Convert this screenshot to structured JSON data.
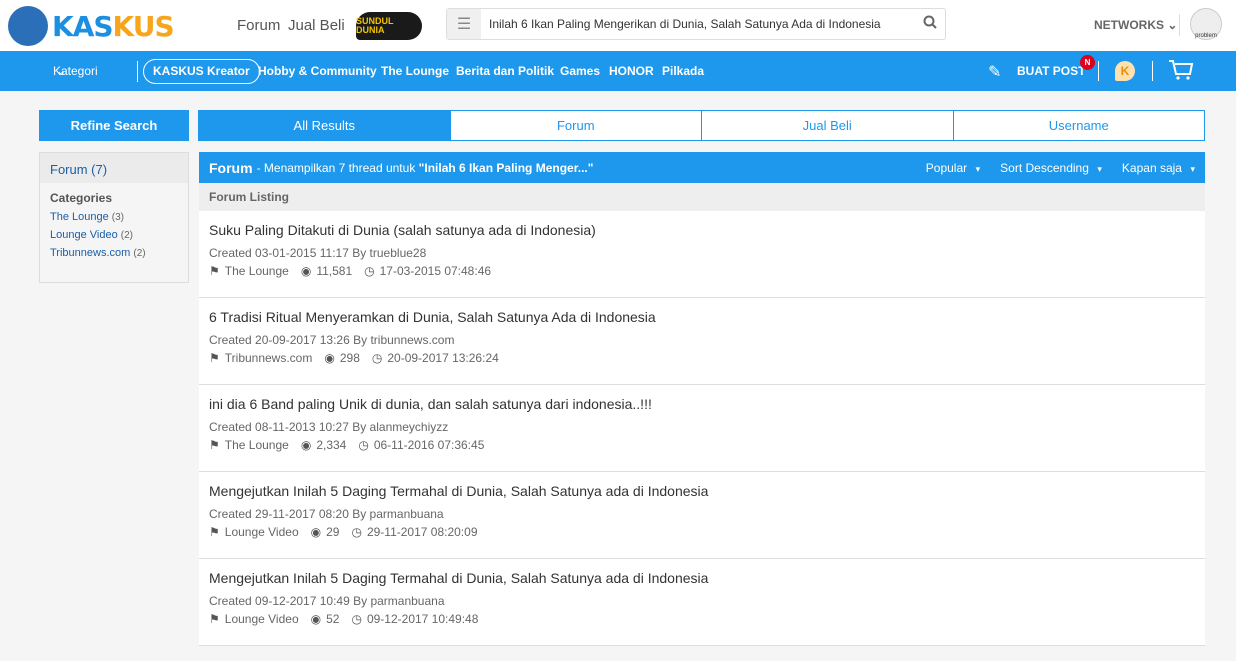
{
  "header": {
    "logo_a": "KAS",
    "logo_b": "KUS",
    "links": [
      "Forum",
      "Jual Beli"
    ],
    "sundul": "SUNDUL DUNIA",
    "search_value": "Inilah 6 Ikan Paling Mengerikan di Dunia, Salah Satunya Ada di Indonesia",
    "networks": "NETWORKS",
    "avatar_caption": "problem"
  },
  "nav": {
    "kategori": "Kategori",
    "kreator": "KASKUS Kreator",
    "items": [
      "Hobby & Community",
      "The Lounge",
      "Berita dan Politik",
      "Games",
      "HONOR",
      "Pilkada"
    ],
    "buat_post": "BUAT POST",
    "badge": "N"
  },
  "colors": {
    "accent": "#1e98ec",
    "badge": "#e0001b"
  },
  "refine": "Refine Search",
  "tabs": [
    "All Results",
    "Forum",
    "Jual Beli",
    "Username"
  ],
  "sidebar": {
    "header": "Forum (7)",
    "categories_label": "Categories",
    "items": [
      {
        "name": "The Lounge",
        "count": "(3)"
      },
      {
        "name": "Lounge Video",
        "count": "(2)"
      },
      {
        "name": "Tribunnews.com",
        "count": "(2)"
      }
    ]
  },
  "main": {
    "title": "Forum",
    "subtitle": "- Menampilkan 7 thread untuk",
    "query": "\"Inilah 6 Ikan Paling Menger...\"",
    "sorts": [
      "Popular",
      "Sort Descending",
      "Kapan saja"
    ],
    "listing": "Forum Listing",
    "threads": [
      {
        "title": "Suku Paling Ditakuti di Dunia (salah satunya ada di Indonesia)",
        "created": "Created 03-01-2015 11:17 By trueblue28",
        "category": "The Lounge",
        "views": "11,581",
        "last": "17-03-2015 07:48:46"
      },
      {
        "title": "6 Tradisi Ritual Menyeramkan di Dunia, Salah Satunya Ada di Indonesia",
        "created": "Created 20-09-2017 13:26 By tribunnews.com",
        "category": "Tribunnews.com",
        "views": "298",
        "last": "20-09-2017 13:26:24"
      },
      {
        "title": "ini dia 6 Band paling Unik di dunia, dan salah satunya dari indonesia..!!!",
        "created": "Created 08-11-2013 10:27 By alanmeychiyzz",
        "category": "The Lounge",
        "views": "2,334",
        "last": "06-11-2016 07:36:45"
      },
      {
        "title": "Mengejutkan Inilah 5 Daging Termahal di Dunia, Salah Satunya ada di Indonesia",
        "created": "Created 29-11-2017 08:20 By parmanbuana",
        "category": "Lounge Video",
        "views": "29",
        "last": "29-11-2017 08:20:09"
      },
      {
        "title": "Mengejutkan Inilah 5 Daging Termahal di Dunia, Salah Satunya ada di Indonesia",
        "created": "Created 09-12-2017 10:49 By parmanbuana",
        "category": "Lounge Video",
        "views": "52",
        "last": "09-12-2017 10:49:48"
      }
    ]
  }
}
